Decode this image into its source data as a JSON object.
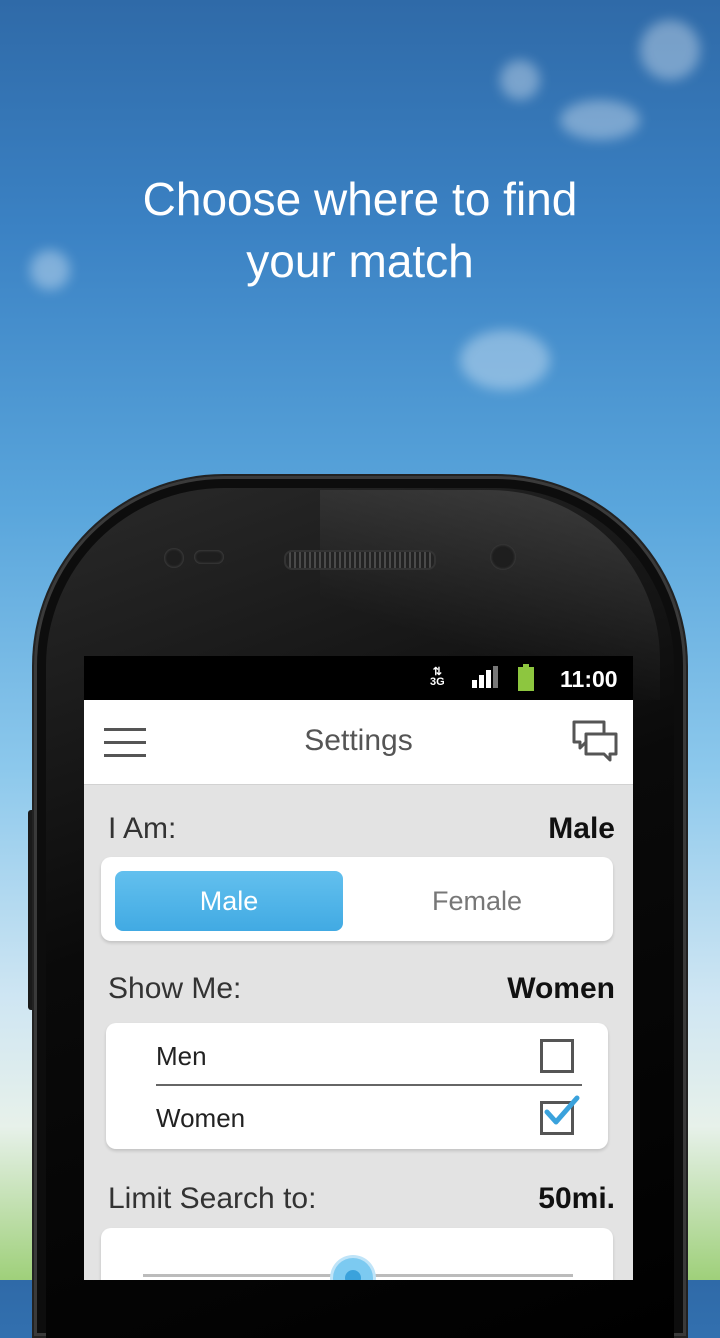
{
  "headline": {
    "line1": "Choose where  to find",
    "line2": "your match"
  },
  "status_bar": {
    "network": "3G",
    "time": "11:00"
  },
  "app_bar": {
    "title": "Settings",
    "menu_icon": "hamburger-menu-icon",
    "chat_icon": "chat-bubbles-icon"
  },
  "i_am": {
    "label": "I Am:",
    "value": "Male",
    "options": [
      "Male",
      "Female"
    ],
    "selected": "Male"
  },
  "show_me": {
    "label": "Show Me:",
    "value": "Women",
    "options": [
      {
        "label": "Men",
        "checked": false
      },
      {
        "label": "Women",
        "checked": true
      }
    ]
  },
  "limit_search": {
    "label": "Limit Search to:",
    "value": "50mi.",
    "slider_fraction": 0.5
  },
  "colors": {
    "accent": "#41aae3",
    "check": "#3aa2dc"
  }
}
